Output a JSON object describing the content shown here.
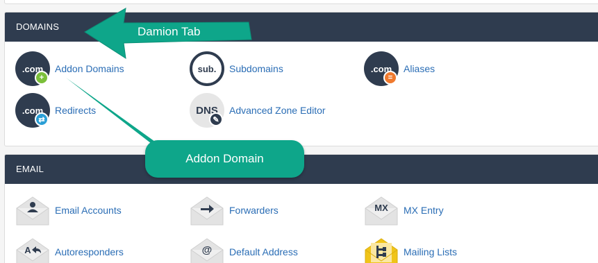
{
  "sections": {
    "domains": {
      "title": "DOMAINS",
      "items": [
        {
          "label": "Addon Domains",
          "icon_text": ".com",
          "icon": "addon-domains-icon",
          "badge": "+"
        },
        {
          "label": "Subdomains",
          "icon_text": "sub.",
          "icon": "subdomains-icon"
        },
        {
          "label": "Aliases",
          "icon_text": ".com",
          "icon": "aliases-icon",
          "badge": "="
        },
        {
          "label": "Redirects",
          "icon_text": ".com",
          "icon": "redirects-icon",
          "badge": "⇄"
        },
        {
          "label": "Advanced Zone Editor",
          "icon_text": "DNS",
          "icon": "zone-editor-icon",
          "badge": "✎"
        }
      ]
    },
    "email": {
      "title": "EMAIL",
      "items": [
        {
          "label": "Email Accounts",
          "icon": "email-accounts-icon"
        },
        {
          "label": "Forwarders",
          "icon": "forwarders-icon"
        },
        {
          "label": "MX Entry",
          "icon_text": "MX",
          "icon": "mx-entry-icon"
        },
        {
          "label": "Autoresponders",
          "icon_text": "A",
          "icon": "autoresponders-icon"
        },
        {
          "label": "Default Address",
          "icon_text": "@",
          "icon": "default-address-icon"
        },
        {
          "label": "Mailing Lists",
          "icon": "mailing-lists-icon"
        }
      ]
    }
  },
  "annotations": {
    "tab_callout": "Damion Tab",
    "addon_callout": "Addon Domain"
  },
  "colors": {
    "header_bg": "#2f3c4f",
    "link": "#2a6db5",
    "callout": "#0ea68a"
  }
}
